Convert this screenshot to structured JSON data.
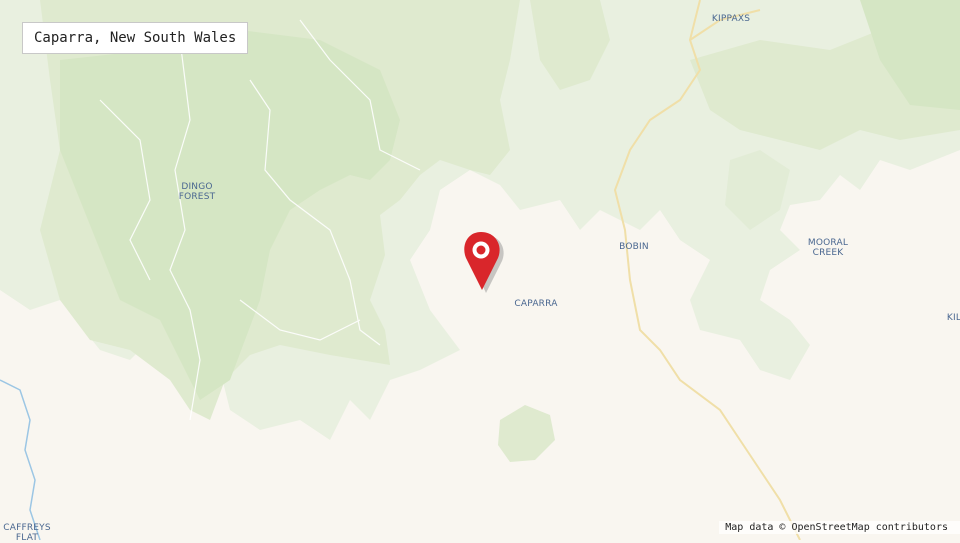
{
  "map": {
    "title": "Caparra, New South Wales",
    "attribution": "Map data © OpenStreetMap contributors",
    "marker": {
      "label": "Caparra",
      "icon": "map-pin-icon",
      "color": "#d9262b"
    },
    "colors": {
      "background": "#f9f6f0",
      "forest_light": "#e9f0e0",
      "forest_medium": "#dfeacf",
      "forest_dark": "#d5e6c4",
      "road": "#f2e3b3",
      "river": "#9cc6e4",
      "label": "#4a6790"
    },
    "places": [
      {
        "id": "kippaxs",
        "lines": [
          "KIPPAXS"
        ]
      },
      {
        "id": "dingo-forest",
        "lines": [
          "DINGO",
          "FOREST"
        ]
      },
      {
        "id": "bobin",
        "lines": [
          "BOBIN"
        ]
      },
      {
        "id": "mooral-creek",
        "lines": [
          "MOORAL",
          "CREEK"
        ]
      },
      {
        "id": "caparra",
        "lines": [
          "CAPARRA"
        ]
      },
      {
        "id": "caffreys-flat",
        "lines": [
          "CAFFREYS",
          "FLAT"
        ]
      },
      {
        "id": "kil",
        "lines": [
          "KIL"
        ]
      }
    ]
  }
}
